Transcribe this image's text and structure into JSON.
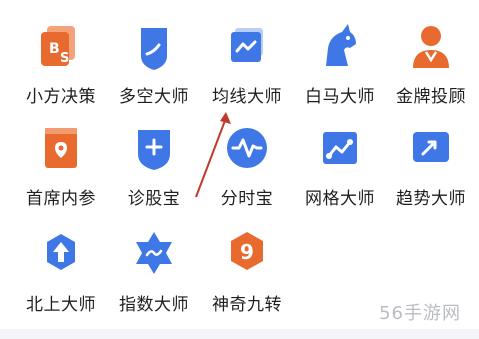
{
  "features": [
    {
      "label": "小方决策",
      "icon": "bs-doc-icon",
      "color": "#e86a2f"
    },
    {
      "label": "多空大师",
      "icon": "shield-line-icon",
      "color": "#3f78e6"
    },
    {
      "label": "均线大师",
      "icon": "chart-wave-icon",
      "color": "#3f78e6"
    },
    {
      "label": "白马大师",
      "icon": "horse-icon",
      "color": "#3f78e6"
    },
    {
      "label": "金牌投顾",
      "icon": "advisor-icon",
      "color": "#e86a2f"
    },
    {
      "label": "首席内参",
      "icon": "book-icon",
      "color": "#e86a2f"
    },
    {
      "label": "诊股宝",
      "icon": "shield-plus-icon",
      "color": "#3f78e6"
    },
    {
      "label": "分时宝",
      "icon": "pulse-icon",
      "color": "#3f78e6"
    },
    {
      "label": "网格大师",
      "icon": "grid-line-icon",
      "color": "#3f78e6"
    },
    {
      "label": "趋势大师",
      "icon": "trend-icon",
      "color": "#3f78e6"
    },
    {
      "label": "北上大师",
      "icon": "up-arrow-gear-icon",
      "color": "#3f78e6"
    },
    {
      "label": "指数大师",
      "icon": "index-star-icon",
      "color": "#3f78e6"
    },
    {
      "label": "神奇九转",
      "icon": "nine-hex-icon",
      "color": "#e86a2f"
    }
  ],
  "watermark": "56手游网"
}
